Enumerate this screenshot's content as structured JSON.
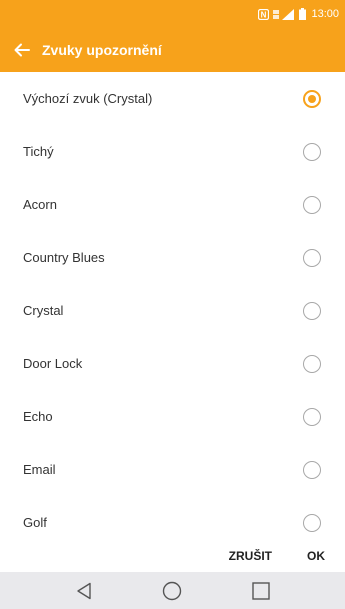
{
  "status_bar": {
    "time": "13:00",
    "icons": [
      "nfc-icon",
      "signal-icon",
      "battery-icon"
    ]
  },
  "app_bar": {
    "title": "Zvuky upozornění",
    "back_icon": "back-arrow-icon",
    "color": "#f7a21b"
  },
  "sounds": [
    {
      "label": "Výchozí zvuk (Crystal)",
      "selected": true
    },
    {
      "label": "Tichý",
      "selected": false
    },
    {
      "label": "Acorn",
      "selected": false
    },
    {
      "label": "Country Blues",
      "selected": false
    },
    {
      "label": "Crystal",
      "selected": false
    },
    {
      "label": "Door Lock",
      "selected": false
    },
    {
      "label": "Echo",
      "selected": false
    },
    {
      "label": "Email",
      "selected": false
    },
    {
      "label": "Golf",
      "selected": false
    }
  ],
  "actions": {
    "cancel_label": "ZRUŠIT",
    "ok_label": "OK"
  },
  "nav_bar": {
    "icons": [
      "back-triangle-icon",
      "home-circle-icon",
      "recents-square-icon"
    ]
  }
}
